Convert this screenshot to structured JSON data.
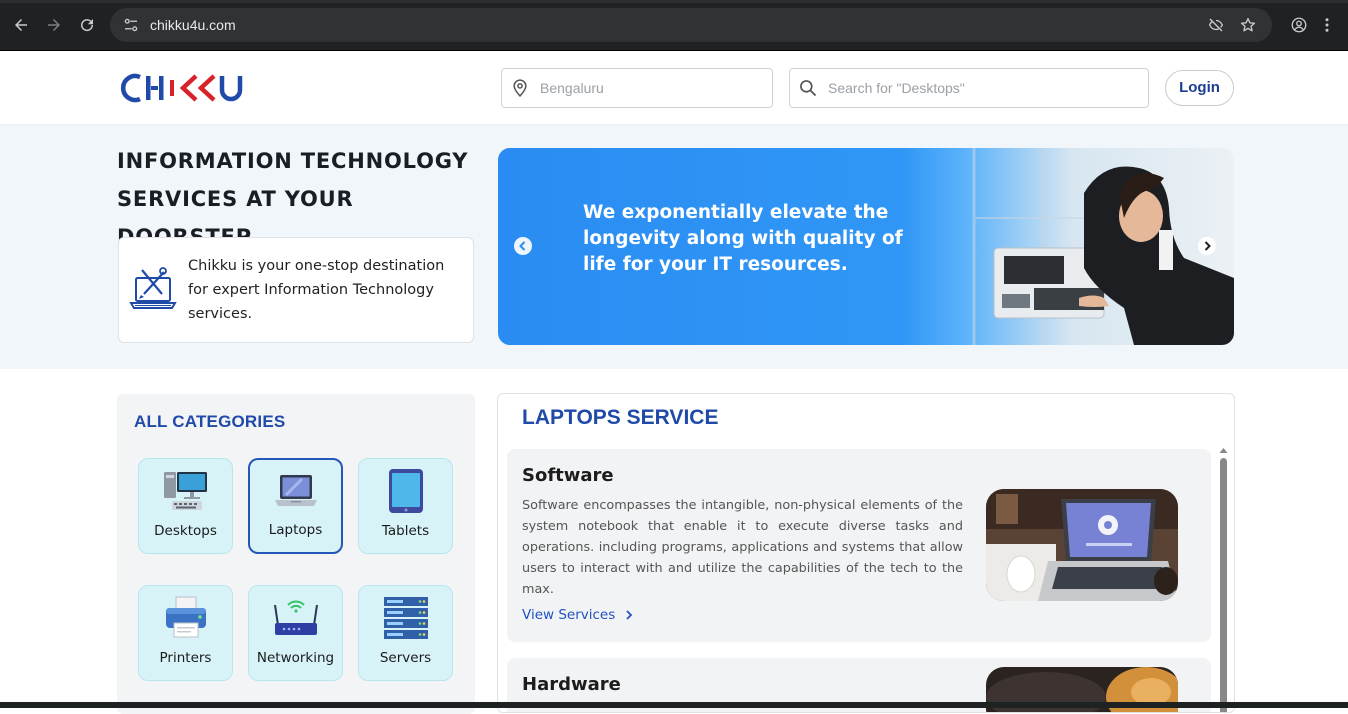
{
  "browser": {
    "url": "chikku4u.com",
    "icons": [
      "back-arrow-icon",
      "forward-arrow-icon",
      "reload-icon",
      "site-info-icon",
      "eye-off-icon",
      "bookmark-star-icon",
      "profile-icon",
      "kebab-menu-icon"
    ]
  },
  "header": {
    "logo_text": "CHIKKU",
    "location_placeholder": "Bengaluru",
    "search_placeholder": "Search for \"Desktops\"",
    "login_label": "Login"
  },
  "hero": {
    "title_line1": "INFORMATION TECHNOLOGY",
    "title_line2": "SERVICES AT YOUR DOORSTEP",
    "card_text": "Chikku is your one-stop destination for expert Information Technology services.",
    "banner_text": "We exponentially elevate the longevity along with quality of life for your IT resources."
  },
  "categories": {
    "title": "ALL CATEGORIES",
    "selected": "Laptops",
    "items": [
      {
        "label": "Desktops",
        "icon": "desktop-icon"
      },
      {
        "label": "Laptops",
        "icon": "laptop-icon"
      },
      {
        "label": "Tablets",
        "icon": "tablet-icon"
      },
      {
        "label": "Printers",
        "icon": "printer-icon"
      },
      {
        "label": "Networking",
        "icon": "router-icon"
      },
      {
        "label": "Servers",
        "icon": "server-icon"
      }
    ]
  },
  "service": {
    "title": "LAPTOPS SERVICE",
    "cards": [
      {
        "title": "Software",
        "description": "Software encompasses the intangible, non-physical elements of the system notebook that enable it to execute diverse tasks and operations. including programs, applications and systems that allow users to interact with and utilize the capabilities of the tech to the max.",
        "link": "View Services"
      },
      {
        "title": "Hardware"
      }
    ]
  },
  "colors": {
    "brand_blue": "#1f4aa8",
    "brand_red": "#d6232a",
    "banner_blue": "#2a8cf2",
    "tile_bg": "#d7f3f8"
  }
}
